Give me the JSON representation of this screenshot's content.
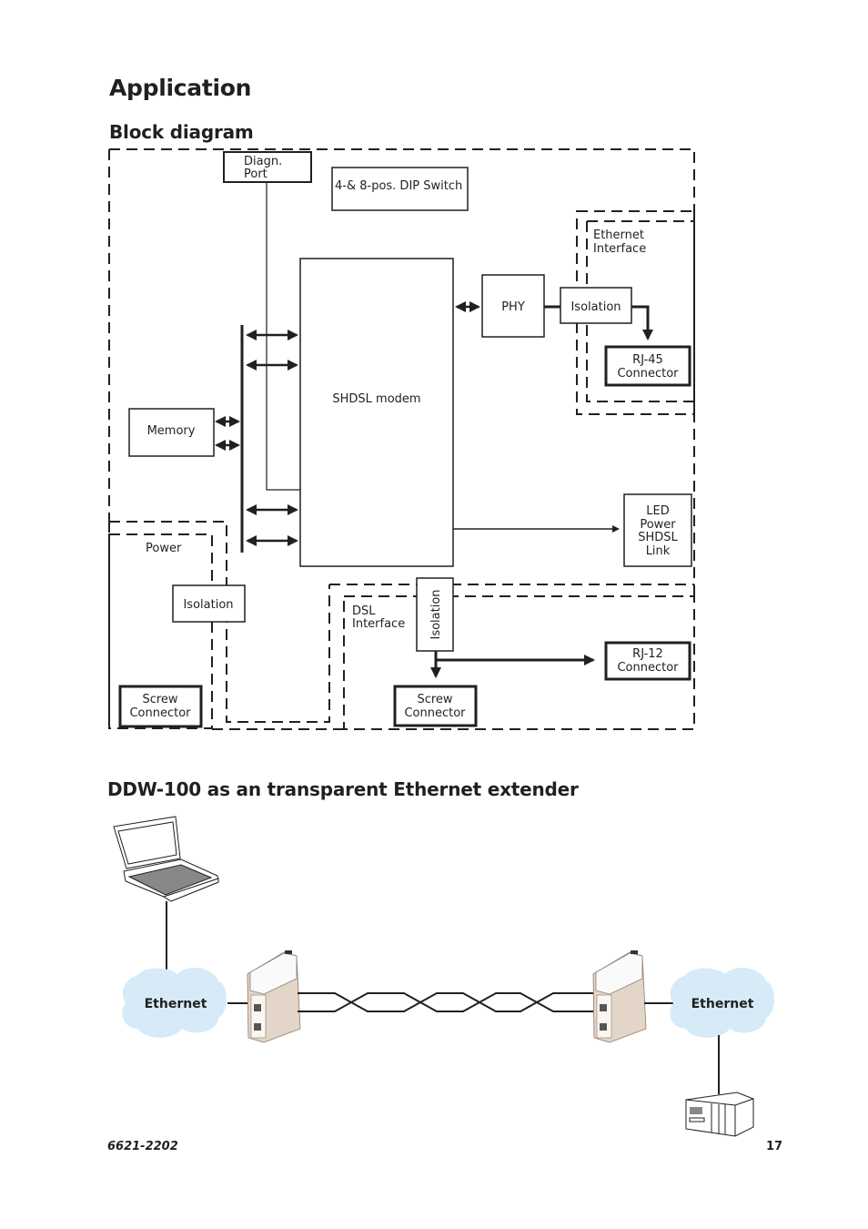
{
  "page": {
    "title": "Application",
    "section1_title": "Block diagram",
    "section2_title": "DDW-100 as an transparent Ethernet extender",
    "doc_number": "6621-2202",
    "page_number": "17"
  },
  "block_diagram": {
    "blocks": {
      "diagn_port": [
        "Diagn.",
        "Port"
      ],
      "dip_switch": "4-& 8-pos. DIP Switch",
      "ethernet_interface": [
        "Ethernet",
        "Interface"
      ],
      "phy": "PHY",
      "isolation_eth": "Isolation",
      "rj45": [
        "RJ-45",
        "Connector"
      ],
      "shdsl_modem": "SHDSL modem",
      "memory": "Memory",
      "led": [
        "LED",
        "Power",
        "SHDSL",
        "Link"
      ],
      "power": "Power",
      "isolation_power": "Isolation",
      "screw_power": [
        "Screw",
        "Connector"
      ],
      "dsl_interface": [
        "DSL",
        "Interface"
      ],
      "isolation_dsl": "Isolation",
      "rj12": [
        "RJ-12",
        "Connector"
      ],
      "screw_dsl": [
        "Screw",
        "Connector"
      ]
    }
  },
  "network_diagram": {
    "cloud_left": "Ethernet",
    "cloud_right": "Ethernet",
    "cloud_color": "#d6ebf7",
    "device_color": "#e3d5c8",
    "nodes": [
      "laptop-icon",
      "ddw100-device-left",
      "ddw100-device-right",
      "plc-icon"
    ]
  }
}
